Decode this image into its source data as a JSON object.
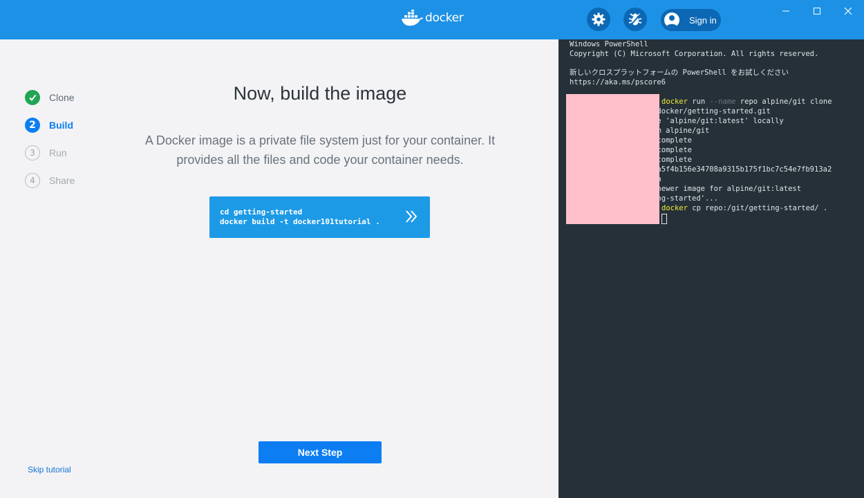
{
  "app": {
    "logo_text": "docker",
    "signin_label": "Sign in"
  },
  "colors": {
    "titlebar": "#1d91e6",
    "accent": "#0d7ef2",
    "done": "#22a455",
    "terminal_bg": "#253038"
  },
  "steps": [
    {
      "number": "1",
      "label": "Clone",
      "state": "done"
    },
    {
      "number": "2",
      "label": "Build",
      "state": "active"
    },
    {
      "number": "3",
      "label": "Run",
      "state": "pending"
    },
    {
      "number": "4",
      "label": "Share",
      "state": "pending"
    }
  ],
  "main": {
    "title": "Now, build the image",
    "description": "A Docker image is a private file system just for your container. It provides all the files and code your container needs.",
    "command_lines": [
      "cd getting-started",
      "docker build -t docker101tutorial ."
    ],
    "next_label": "Next Step",
    "skip_label": "Skip tutorial"
  },
  "terminal": {
    "lines": [
      "Windows PowerShell",
      "Copyright (C) Microsoft Corporation. All rights reserved.",
      "",
      "新しいクロスプラットフォームの PowerShell をお試しください",
      "https://aka.ms/pscore6",
      "",
      "                    docker run --name repo alpine/git clone",
      "                   /docker/getting-started.git",
      "                   ge 'alpine/git:latest' locally",
      "                   om alpine/git",
      "                    complete",
      "                    complete",
      "                    complete",
      "                   0a5f4b156e34708a9315b175f1bc7c54e7fb913a2",
      "                   8a",
      "                    newer image for alpine/git:latest",
      "                   ing-started'...",
      "                    docker cp repo:/git/getting-started/ ."
    ],
    "cmd1": {
      "pre": "docker",
      "mid": " run ",
      "flag": "--name",
      "post": " repo alpine/git clone"
    },
    "cmd2": {
      "pre": "docker",
      "post": " cp repo:/git/getting-started/ ."
    }
  },
  "icons": [
    "docker-whale-icon",
    "gear-icon",
    "bug-icon",
    "user-avatar-icon",
    "minimize-icon",
    "maximize-icon",
    "close-icon",
    "check-icon",
    "copy-chevrons-icon"
  ]
}
